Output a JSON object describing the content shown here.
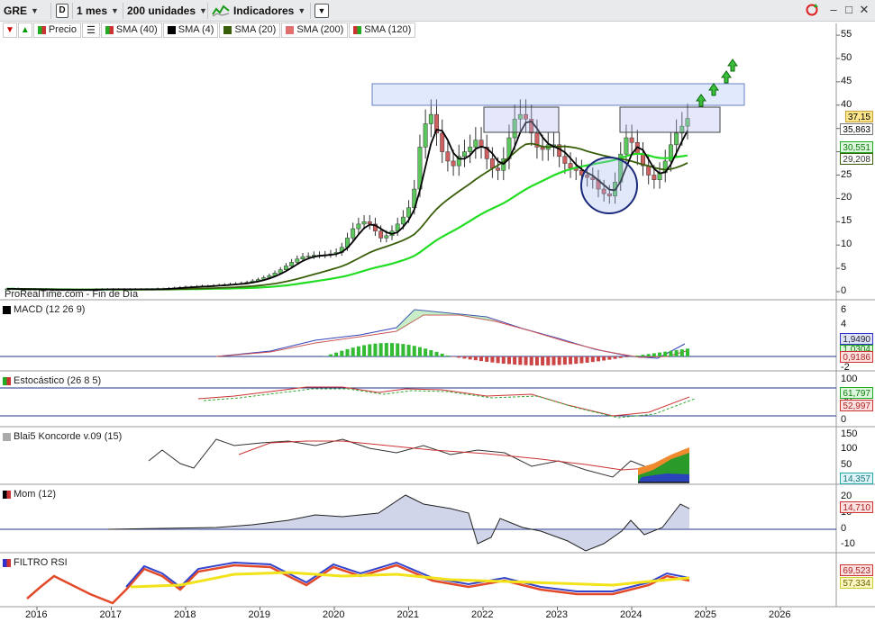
{
  "toolbar": {
    "ticker": "GRE",
    "d_label": "D",
    "timeframe": "1 mes",
    "units": "200 unidades",
    "indicators": "Indicadores",
    "colors": {
      "bg": "#e9eaec"
    }
  },
  "legend": {
    "price": "Precio",
    "items": [
      {
        "label": "SMA (40)",
        "color": "#2db92d"
      },
      {
        "label": "SMA (4)",
        "color": "#000000"
      },
      {
        "label": "SMA (20)",
        "color": "#3a5f0b"
      },
      {
        "label": "SMA (200)",
        "color": "#e07070"
      },
      {
        "label": "SMA (120)",
        "color": "#20c020"
      }
    ]
  },
  "watermark": "ProRealTime.com - Fin de Día",
  "panels": {
    "macd": {
      "label": "MACD (12 26 9)",
      "ticks": [
        "6",
        "4",
        "2",
        "0",
        "-2"
      ],
      "tags": [
        "1,9490",
        "1,0304",
        "0,9186"
      ]
    },
    "stoch": {
      "label": "Estocástico (26 8 5)",
      "ticks": [
        "100",
        "50",
        "0"
      ],
      "tags": [
        "61,797",
        "52,997"
      ]
    },
    "koncorde": {
      "label": "Blai5 Koncorde v.09 (15)",
      "ticks": [
        "150",
        "100",
        "50",
        "0"
      ],
      "tags": [
        "14,357"
      ]
    },
    "mom": {
      "label": "Mom (12)",
      "ticks": [
        "20",
        "10",
        "0",
        "-10"
      ],
      "tags": [
        "14,710"
      ]
    },
    "rsi": {
      "label": "FILTRO RSI",
      "tags": [
        "69,523",
        "57,334"
      ]
    }
  },
  "price_axis": {
    "ticks": [
      "55",
      "50",
      "45",
      "40",
      "35",
      "30",
      "25",
      "20",
      "15",
      "10",
      "5",
      "0"
    ],
    "tags": {
      "last": "37,15",
      "sma4": "35,863",
      "sma40": "30,551",
      "sma20": "29,208"
    }
  },
  "time_axis": [
    "2016",
    "2017",
    "2018",
    "2019",
    "2020",
    "2021",
    "2022",
    "2023",
    "2024",
    "2025",
    "2026"
  ],
  "chart_data": {
    "type": "candlestick",
    "interval": "1 month",
    "x_labels": [
      "2016",
      "2017",
      "2018",
      "2019",
      "2020",
      "2021",
      "2022",
      "2023",
      "2024",
      "2025",
      "2026"
    ],
    "ylim": [
      0,
      55
    ],
    "last_close": 37.15,
    "sma": {
      "sma4": 35.863,
      "sma40": 30.551,
      "sma20": 29.208
    },
    "close_approx": [
      0.6,
      0.6,
      0.5,
      0.5,
      0.5,
      0.5,
      0.5,
      0.4,
      0.4,
      0.4,
      0.4,
      0.4,
      0.4,
      0.4,
      0.4,
      0.4,
      0.5,
      0.5,
      0.5,
      0.5,
      0.5,
      0.5,
      0.5,
      0.5,
      0.5,
      0.5,
      0.5,
      0.6,
      0.6,
      0.7,
      0.8,
      0.9,
      1.0,
      1.0,
      1.1,
      1.2,
      1.2,
      1.3,
      1.4,
      1.5,
      1.6,
      1.7,
      1.8,
      2.0,
      2.3,
      2.6,
      3.0,
      3.4,
      4.0,
      4.7,
      5.5,
      6.3,
      7.0,
      7.5,
      7.6,
      7.8,
      7.8,
      7.9,
      8.1,
      8.4,
      9.5,
      11.5,
      13.5,
      14.5,
      15.0,
      14.5,
      13.0,
      11.5,
      12.0,
      13.0,
      14.5,
      16.0,
      18.0,
      22.0,
      31.0,
      36.0,
      38.0,
      34.0,
      30.0,
      28.0,
      27.0,
      29.0,
      30.0,
      31.0,
      32.5,
      31.0,
      28.5,
      26.5,
      26.0,
      28.5,
      33.0,
      37.0,
      38.0,
      37.0,
      34.0,
      31.0,
      30.5,
      31.5,
      31.5,
      29.0,
      27.5,
      26.5,
      26.0,
      25.0,
      24.5,
      24.0,
      22.0,
      21.0,
      20.5,
      23.5,
      29.5,
      33.0,
      32.0,
      29.5,
      27.0,
      25.0,
      24.0,
      25.5,
      28.0,
      31.5,
      34.0,
      35.5,
      37.15
    ],
    "panels": {
      "macd": {
        "ylim": [
          -2,
          7
        ],
        "last": [
          1.949,
          1.0304,
          0.9186
        ]
      },
      "stochastic": {
        "ylim": [
          0,
          100
        ],
        "last": [
          61.797,
          52.997
        ]
      },
      "koncorde": {
        "ylim": [
          -10,
          160
        ],
        "last": 14.357
      },
      "momentum": {
        "ylim": [
          -15,
          25
        ],
        "last": 14.71
      },
      "rsi_filter": {
        "last": [
          69.523,
          57.334
        ]
      }
    }
  }
}
